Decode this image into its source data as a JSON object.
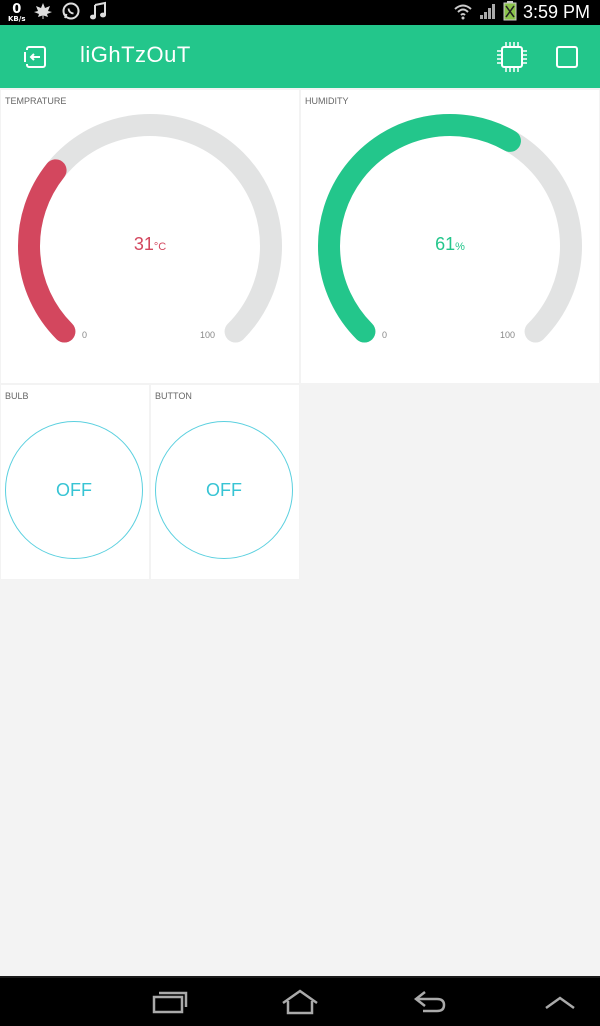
{
  "status_bar": {
    "data_rate_value": "0",
    "data_rate_unit": "KB/s",
    "time": "3:59 PM",
    "notification_icons": [
      "maple-leaf-icon",
      "whatsapp-icon",
      "music-note-icon"
    ],
    "system_icons": [
      "wifi-icon",
      "signal-icon",
      "battery-icon"
    ]
  },
  "app_bar": {
    "title": "liGhTzOuT",
    "color": "#23c68b",
    "left_icon": "exit-project-icon",
    "right_icons": [
      "device-chip-icon",
      "play-stop-icon"
    ]
  },
  "widgets": {
    "temperature": {
      "label": "TEMPRATURE",
      "value": "31",
      "unit": "°C",
      "min_label": "0",
      "max_label": "100",
      "min": 0,
      "max": 100,
      "numeric_value": 31,
      "color": "#d3475e",
      "track_color": "#e2e3e3"
    },
    "humidity": {
      "label": "HUMIDITY",
      "value": "61",
      "unit": "%",
      "min_label": "0",
      "max_label": "100",
      "min": 0,
      "max": 100,
      "numeric_value": 61,
      "color": "#23c68b",
      "track_color": "#e2e3e3"
    },
    "bulb": {
      "label": "BULB",
      "state": "OFF",
      "color": "#37c4d4"
    },
    "button": {
      "label": "BUTTON",
      "state": "OFF",
      "color": "#37c4d4"
    }
  },
  "nav_bar": {
    "buttons": [
      "recent-apps-icon",
      "home-icon",
      "back-icon",
      "menu-up-icon"
    ]
  }
}
